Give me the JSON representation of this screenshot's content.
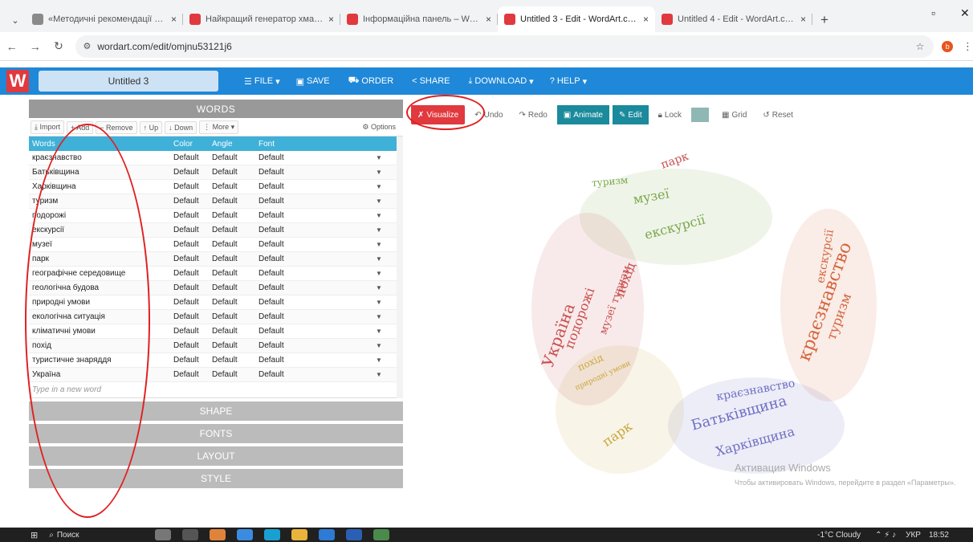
{
  "browser": {
    "tabs": [
      {
        "title": "«Методичні рекомендації по...",
        "fav_color": "#8a8a8a",
        "active": false
      },
      {
        "title": "Найкращий генератор хмар...",
        "fav_color": "#e0393e",
        "active": false
      },
      {
        "title": "Інформаційна панель – Word...",
        "fav_color": "#e0393e",
        "active": false
      },
      {
        "title": "Untitled 3 - Edit - WordArt.com",
        "fav_color": "#e0393e",
        "active": true
      },
      {
        "title": "Untitled 4 - Edit - WordArt.com",
        "fav_color": "#e0393e",
        "active": false
      }
    ],
    "url": "wordart.com/edit/omjnu53121j6",
    "ext_label": "b"
  },
  "app": {
    "logo": "W",
    "doc_title": "Untitled 3",
    "menu": [
      {
        "label": "FILE",
        "icon": "☰",
        "caret": "▾"
      },
      {
        "label": "SAVE",
        "icon": "▣",
        "caret": ""
      },
      {
        "label": "ORDER",
        "icon": "⛟",
        "caret": ""
      },
      {
        "label": "SHARE",
        "icon": "<",
        "caret": ""
      },
      {
        "label": "DOWNLOAD",
        "icon": "⤓",
        "caret": "▾"
      },
      {
        "label": "HELP",
        "icon": "?",
        "caret": "▾"
      }
    ]
  },
  "words": {
    "section_title": "WORDS",
    "toolbar": {
      "import": "Import",
      "add": "Add",
      "remove": "Remove",
      "up": "Up",
      "down": "Down",
      "more": "More",
      "options": "Options"
    },
    "columns": [
      "Words",
      "Color",
      "Angle",
      "Font"
    ],
    "rows": [
      {
        "word": "краєзнавство",
        "color": "Default",
        "angle": "Default",
        "font": "Default"
      },
      {
        "word": "Батьківщина",
        "color": "Default",
        "angle": "Default",
        "font": "Default"
      },
      {
        "word": "Харківщина",
        "color": "Default",
        "angle": "Default",
        "font": "Default"
      },
      {
        "word": "туризм",
        "color": "Default",
        "angle": "Default",
        "font": "Default"
      },
      {
        "word": "подорожі",
        "color": "Default",
        "angle": "Default",
        "font": "Default"
      },
      {
        "word": "екскурсії",
        "color": "Default",
        "angle": "Default",
        "font": "Default"
      },
      {
        "word": "музеї",
        "color": "Default",
        "angle": "Default",
        "font": "Default"
      },
      {
        "word": "парк",
        "color": "Default",
        "angle": "Default",
        "font": "Default"
      },
      {
        "word": "географічне середовище",
        "color": "Default",
        "angle": "Default",
        "font": "Default"
      },
      {
        "word": "геологічна будова",
        "color": "Default",
        "angle": "Default",
        "font": "Default"
      },
      {
        "word": "природні умови",
        "color": "Default",
        "angle": "Default",
        "font": "Default"
      },
      {
        "word": "екологічна ситуація",
        "color": "Default",
        "angle": "Default",
        "font": "Default"
      },
      {
        "word": "кліматичні умови",
        "color": "Default",
        "angle": "Default",
        "font": "Default"
      },
      {
        "word": "похід",
        "color": "Default",
        "angle": "Default",
        "font": "Default"
      },
      {
        "word": "туристичне знаряддя",
        "color": "Default",
        "angle": "Default",
        "font": "Default"
      },
      {
        "word": "Україна",
        "color": "Default",
        "angle": "Default",
        "font": "Default"
      }
    ],
    "new_word_placeholder": "Type in a new word"
  },
  "sections": {
    "shape": "SHAPE",
    "fonts": "FONTS",
    "layout": "LAYOUT",
    "style": "STYLE"
  },
  "canvas_toolbar": {
    "visualize": "Visualize",
    "undo": "Undo",
    "redo": "Redo",
    "animate": "Animate",
    "edit": "Edit",
    "lock": "Lock",
    "grid": "Grid",
    "reset": "Reset"
  },
  "cloud_colors": [
    "#c94f4f",
    "#7aa84a",
    "#d4643c",
    "#6f6fc4",
    "#c9a63c"
  ],
  "cloud_words": [
    {
      "t": "музеї",
      "c": 1,
      "s": 16
    },
    {
      "t": "екскурсії",
      "c": 1,
      "s": 16
    },
    {
      "t": "туризм",
      "c": 1,
      "s": 12
    },
    {
      "t": "парк",
      "c": 0,
      "s": 14
    },
    {
      "t": "Україна",
      "c": 0,
      "s": 20
    },
    {
      "t": "подорожі",
      "c": 0,
      "s": 16
    },
    {
      "t": "похід",
      "c": 0,
      "s": 16
    },
    {
      "t": "музеї туризм",
      "c": 0,
      "s": 13
    },
    {
      "t": "краєзнавство",
      "c": 2,
      "s": 22
    },
    {
      "t": "туризм",
      "c": 2,
      "s": 16
    },
    {
      "t": "екскурсії",
      "c": 2,
      "s": 14
    },
    {
      "t": "Батьківщина",
      "c": 3,
      "s": 18
    },
    {
      "t": "краєзнавство",
      "c": 3,
      "s": 14
    },
    {
      "t": "Харківщина",
      "c": 3,
      "s": 16
    },
    {
      "t": "парк",
      "c": 4,
      "s": 16
    },
    {
      "t": "похід",
      "c": 4,
      "s": 12
    },
    {
      "t": "природні умови",
      "c": 4,
      "s": 9
    }
  ],
  "overlay": {
    "title": "Активация Windows",
    "text": "Чтобы активировать Windows, перейдите в раздел «Параметры»."
  },
  "taskbar": {
    "search": "Поиск",
    "weather": "-1°C Cloudy",
    "lang": "УКР",
    "time": "18:52"
  }
}
